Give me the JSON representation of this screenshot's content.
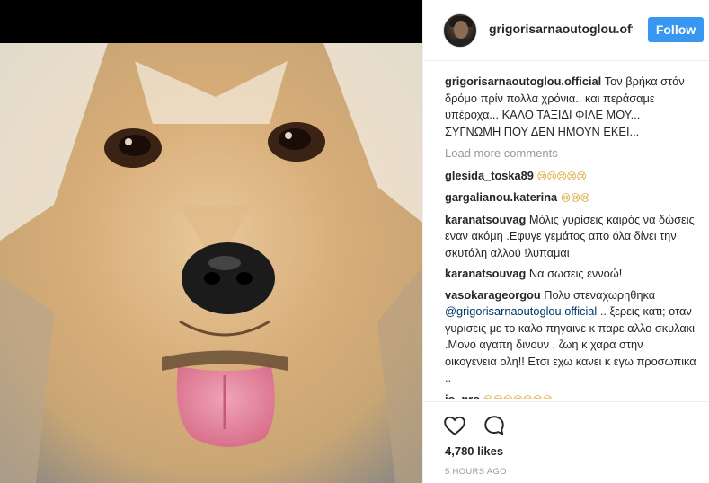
{
  "post": {
    "author": "grigorisarnaoutoglou.official",
    "follow_label": "Follow",
    "caption_user": "grigorisarnaoutoglou.official",
    "caption_text": "Τον βρήκα στόν δρόμο πρίν πολλα χρόνια.. και περάσαμε υπέροχα... ΚΑΛΟ ΤΑΞΙΔΙ ΦΙΛΕ ΜΟΥ... ΣΥΓΝΩΜΗ ΠΟΥ ΔΕΝ ΗΜΟΥΝ ΕΚΕΙ...",
    "load_more": "Load more comments",
    "likes": "4,780 likes",
    "time": "5 HOURS AGO"
  },
  "comments": [
    {
      "user": "glesida_toska89",
      "text": "",
      "emoji": "😢😢😢😢😢"
    },
    {
      "user": "gargalianou.katerina",
      "text": "",
      "emoji": "😢😢😢"
    },
    {
      "user": "karanatsouvag",
      "text": "Μόλις γυρίσεις καιρός να δώσεις εναν ακόμη .Εφυγε γεμάτος απο όλα δίνει την σκυτάλη αλλού !λυπαμαι",
      "emoji": ""
    },
    {
      "user": "karanatsouvag",
      "text": "Να σωσεις εννοώ!",
      "emoji": ""
    },
    {
      "user": "vasokarageorgou",
      "text": "Πολυ στεναχωρηθηκα",
      "mention": "@grigorisarnaoutoglou.official",
      "text2": ".. ξερεις κατι; οταν γυρισεις με το καλο πηγαινε κ παρε αλλο σκυλακι .Μονο αγαπη δινουν , ζωη κ χαρα στην οικογενεια ολη!! Ετσι εχω κανει κ εγω προσωπικα ..",
      "emoji": ""
    },
    {
      "user": "io_pro",
      "text": "",
      "emoji": "😢😢😢😢😢😢😢"
    }
  ],
  "colors": {
    "follow_button": "#3897f0",
    "mention": "#003569",
    "muted": "#999999"
  },
  "icons": [
    "heart-icon",
    "comment-icon"
  ]
}
